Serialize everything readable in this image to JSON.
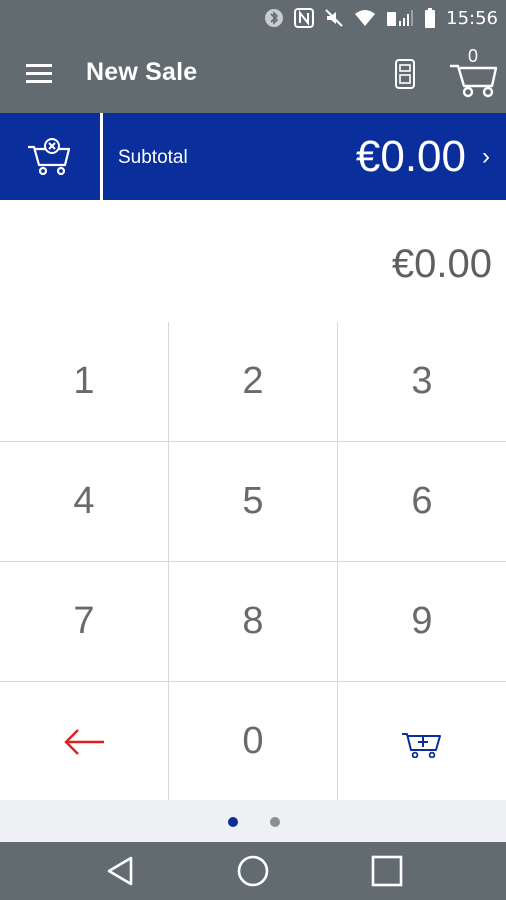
{
  "status_bar": {
    "time": "15:56",
    "icons": [
      "bluetooth-icon",
      "nfc-icon",
      "mute-icon",
      "wifi-icon",
      "signal-icon",
      "battery-icon"
    ]
  },
  "app_bar": {
    "title": "New Sale",
    "cart_count": "0",
    "icons": [
      "menu-icon",
      "card-reader-icon",
      "cart-icon"
    ]
  },
  "subtotal": {
    "label": "Subtotal",
    "amount": "€0.00",
    "chevron": "›"
  },
  "entry": {
    "value": "€0.00"
  },
  "keypad": {
    "keys": [
      "1",
      "2",
      "3",
      "4",
      "5",
      "6",
      "7",
      "8",
      "9",
      "",
      "0",
      ""
    ],
    "backspace_icon": "arrow-left-icon",
    "add_to_cart_icon": "cart-plus-icon"
  },
  "pager": {
    "pages": 2,
    "current": 1
  },
  "colors": {
    "bar_gray": "#616b70",
    "brand_blue": "#0a2f9c",
    "backspace_red": "#e0201e",
    "dot_active": "#0a2f9c",
    "dot_inactive": "#8a8f93"
  },
  "nav_bar": {
    "icons": [
      "back-icon",
      "home-icon",
      "recents-icon"
    ]
  }
}
